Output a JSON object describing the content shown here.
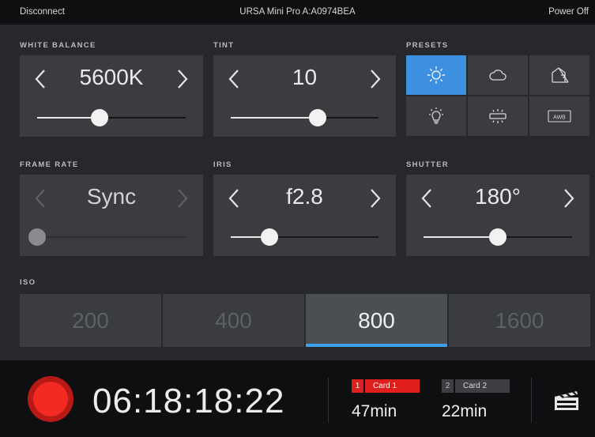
{
  "topbar": {
    "disconnect": "Disconnect",
    "camera_name": "URSA Mini Pro A:A0974BEA",
    "power_off": "Power Off"
  },
  "white_balance": {
    "label": "WHITE BALANCE",
    "value": "5600K",
    "slider_fraction": 0.42
  },
  "tint": {
    "label": "TINT",
    "value": "10",
    "slider_fraction": 0.59
  },
  "presets": {
    "label": "PRESETS",
    "items": [
      {
        "icon": "sun-icon",
        "active": true
      },
      {
        "icon": "cloud-icon",
        "active": false
      },
      {
        "icon": "shade-house-icon",
        "active": false
      },
      {
        "icon": "bulb-icon",
        "active": false
      },
      {
        "icon": "fluorescent-icon",
        "active": false
      },
      {
        "icon": "awb-icon",
        "text": "AWB",
        "active": false
      }
    ]
  },
  "frame_rate": {
    "label": "FRAME RATE",
    "value": "Sync",
    "slider_fraction": 0.0
  },
  "iris": {
    "label": "IRIS",
    "value": "f2.8",
    "slider_fraction": 0.26
  },
  "shutter": {
    "label": "SHUTTER",
    "value": "180°",
    "slider_fraction": 0.5
  },
  "iso": {
    "label": "ISO",
    "options": [
      "200",
      "400",
      "800",
      "1600"
    ],
    "selected": "800"
  },
  "bottom": {
    "timecode": "06:18:18:22",
    "card1": {
      "num": "1",
      "name": "Card 1",
      "remaining": "47min"
    },
    "card2": {
      "num": "2",
      "name": "Card 2",
      "remaining": "22min"
    }
  },
  "colors": {
    "accent_blue": "#3d8fe0",
    "record_red": "#f22a22",
    "panel": "#3a3c40",
    "background": "#26282b"
  }
}
